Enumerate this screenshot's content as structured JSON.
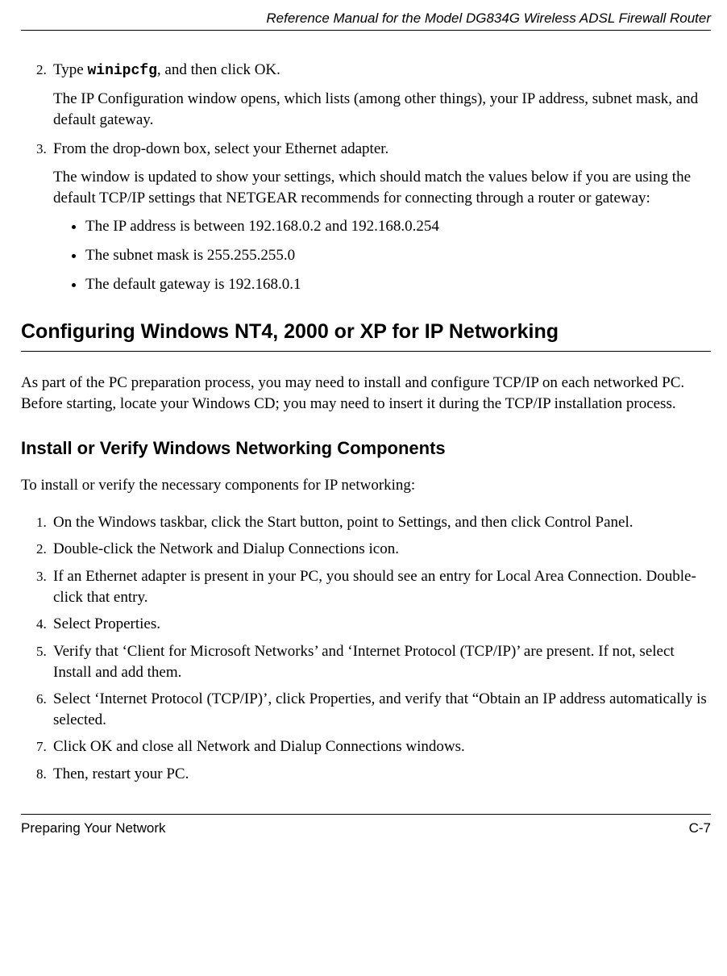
{
  "header": {
    "title": "Reference Manual for the Model DG834G Wireless ADSL Firewall Router"
  },
  "list1": {
    "start": 2,
    "items": [
      {
        "prefix": "Type ",
        "cmd": "winipcfg",
        "suffix": ", and then click OK.",
        "para": "The IP Configuration window opens, which lists (among other things), your IP address, subnet mask, and default gateway."
      },
      {
        "text": "From the drop-down box, select your Ethernet adapter.",
        "para": "The window is updated to show your settings, which should match the values below if you are using the default TCP/IP settings that NETGEAR recommends for connecting through a router or gateway:",
        "bullets": [
          "The IP address is between 192.168.0.2 and 192.168.0.254",
          "The subnet mask is 255.255.255.0",
          "The default gateway is 192.168.0.1"
        ]
      }
    ]
  },
  "section": {
    "heading": "Configuring Windows NT4, 2000 or XP for IP Networking",
    "intro": "As part of the PC preparation process, you may need to install and configure TCP/IP on each networked PC. Before starting, locate your Windows CD; you may need to insert it during the TCP/IP installation process."
  },
  "subsection": {
    "heading": "Install or Verify Windows Networking Components",
    "intro": "To install or verify the necessary components for IP networking:",
    "steps": [
      "On the Windows taskbar, click the Start button, point to Settings, and then click Control Panel.",
      "Double-click the Network and Dialup Connections icon.",
      "If an Ethernet adapter is present in your PC, you should see an entry for Local Area Connection. Double-click that entry.",
      "Select Properties.",
      "Verify that ‘Client for Microsoft Networks’ and ‘Internet Protocol (TCP/IP)’ are present. If not, select Install and add them.",
      "Select ‘Internet Protocol (TCP/IP)’, click Properties, and verify that “Obtain an IP address automatically is selected.",
      "Click OK and close all Network and Dialup Connections windows.",
      "Then, restart your PC."
    ]
  },
  "footer": {
    "left": "Preparing Your Network",
    "right": "C-7"
  }
}
